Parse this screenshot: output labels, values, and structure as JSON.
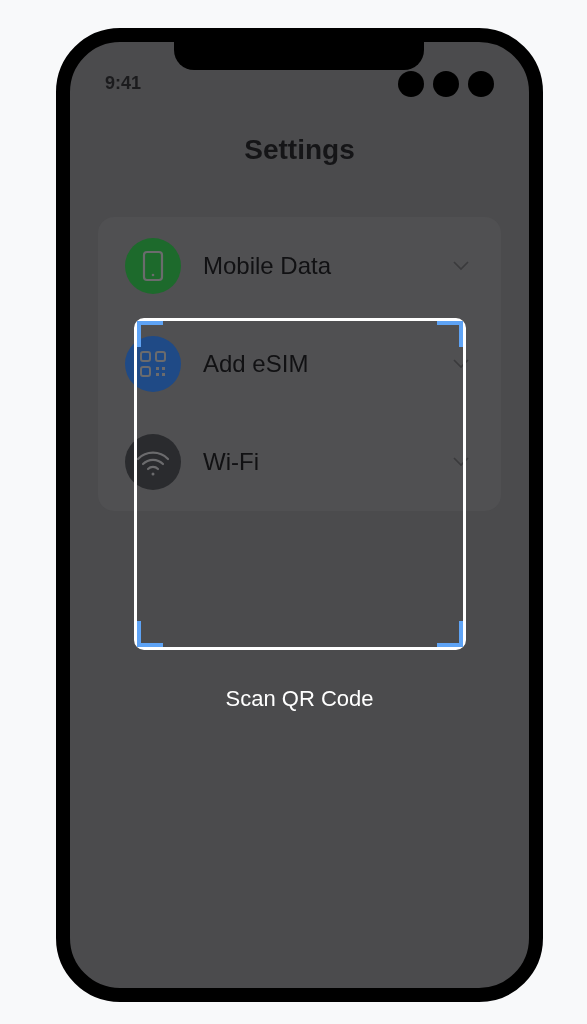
{
  "status_bar": {
    "time": "9:41"
  },
  "title": "Settings",
  "items": [
    {
      "label": "Mobile Data",
      "kind": "phone",
      "color": "#1d6a2c",
      "expanded": false
    },
    {
      "label": "Add eSIM",
      "kind": "qr",
      "color": "#1f4a86",
      "expanded": false
    },
    {
      "label": "Wi-Fi",
      "kind": "wifi",
      "color": "#2a2b2e",
      "expanded": false
    }
  ],
  "scanner": {
    "label": "Scan QR Code"
  }
}
